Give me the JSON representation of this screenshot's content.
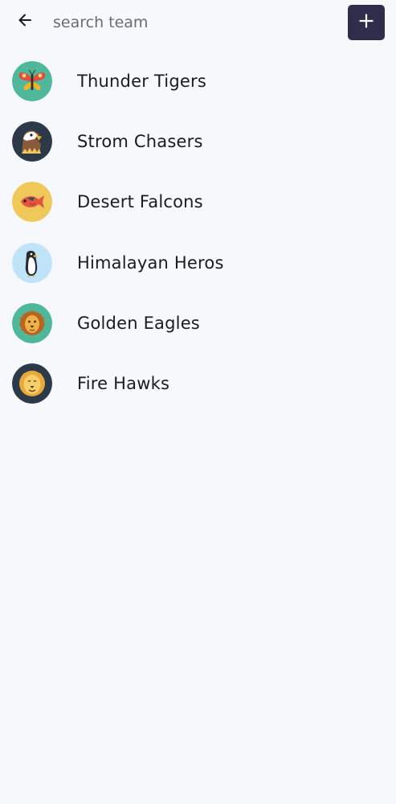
{
  "search": {
    "placeholder": "search team",
    "value": ""
  },
  "icons": {
    "back": "arrow-left-icon",
    "add": "plus-icon"
  },
  "colors": {
    "background": "#f6f8fc",
    "add_button": "#2f2d4c",
    "text": "#1b1b1f"
  },
  "teams": [
    {
      "name": "Thunder Tigers",
      "avatar": "butterfly-icon",
      "avatar_bg": "#4fb89b"
    },
    {
      "name": "Strom Chasers",
      "avatar": "eagle-icon",
      "avatar_bg": "#2b3948"
    },
    {
      "name": "Desert Falcons",
      "avatar": "fish-icon",
      "avatar_bg": "#f0c85a"
    },
    {
      "name": "Himalayan Heros",
      "avatar": "penguin-icon",
      "avatar_bg": "#bfe4f7"
    },
    {
      "name": "Golden Eagles",
      "avatar": "lion-icon",
      "avatar_bg": "#4fb89b"
    },
    {
      "name": "Fire Hawks",
      "avatar": "lion-face-icon",
      "avatar_bg": "#2b3948"
    }
  ]
}
